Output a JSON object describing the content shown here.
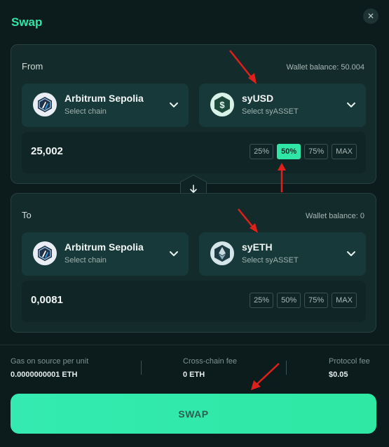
{
  "header": {
    "title": "Swap",
    "close_glyph": "✕"
  },
  "from": {
    "label": "From",
    "wallet_balance": "Wallet balance: 50.004",
    "chain": {
      "name": "Arbitrum Sepolia",
      "sub": "Select chain",
      "icon": "arbitrum-icon"
    },
    "asset": {
      "name": "syUSD",
      "sub": "Select syASSET",
      "icon": "dollar-icon"
    },
    "amount": "25,002",
    "percent_buttons": [
      "25%",
      "50%",
      "75%",
      "MAX"
    ],
    "active_percent": "50%"
  },
  "to": {
    "label": "To",
    "wallet_balance": "Wallet balance: 0",
    "chain": {
      "name": "Arbitrum Sepolia",
      "sub": "Select chain",
      "icon": "arbitrum-icon"
    },
    "asset": {
      "name": "syETH",
      "sub": "Select syASSET",
      "icon": "ethereum-icon"
    },
    "amount": "0,0081",
    "percent_buttons": [
      "25%",
      "50%",
      "75%",
      "MAX"
    ]
  },
  "fees": {
    "gas": {
      "label": "Gas on source per unit",
      "value": "0.0000000001 ETH"
    },
    "cross_chain": {
      "label": "Cross-chain fee",
      "value": "0 ETH"
    },
    "protocol": {
      "label": "Protocol fee",
      "value": "$0.05"
    }
  },
  "swap_button": {
    "label": "SWAP"
  },
  "colors": {
    "accent": "#2fe6a6",
    "background": "#0c1c1c",
    "panel": "#132b2a",
    "annotation_arrow": "#e0201b"
  }
}
